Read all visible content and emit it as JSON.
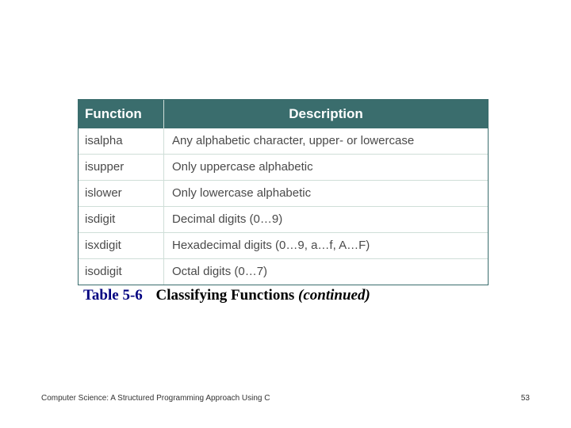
{
  "table": {
    "headers": {
      "function": "Function",
      "description": "Description"
    },
    "rows": [
      {
        "func": "isalpha",
        "desc": "Any alphabetic character, upper- or lowercase"
      },
      {
        "func": "isupper",
        "desc": "Only uppercase alphabetic"
      },
      {
        "func": "islower",
        "desc": "Only lowercase alphabetic"
      },
      {
        "func": "isdigit",
        "desc": "Decimal digits (0…9)"
      },
      {
        "func": "isxdigit",
        "desc": "Hexadecimal digits (0…9, a…f, A…F)"
      },
      {
        "func": "isodigit",
        "desc": "Octal digits (0…7)"
      }
    ]
  },
  "caption": {
    "label": "Table  5-6",
    "title": "Classifying Functions ",
    "tail": "(continued)"
  },
  "footer": {
    "book": "Computer Science: A Structured Programming Approach Using C",
    "page": "53"
  }
}
